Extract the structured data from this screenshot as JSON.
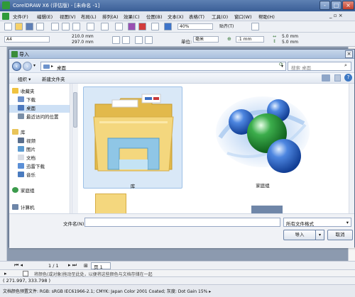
{
  "window": {
    "title": "CorelDRAW X6 (评估版) - [未命名 -1]",
    "controls": [
      "-",
      "□",
      "×"
    ]
  },
  "menu": {
    "items": [
      "文件(F)",
      "编辑(E)",
      "视图(V)",
      "布局(L)",
      "排列(A)",
      "效果(C)",
      "位图(B)",
      "文本(X)",
      "表格(T)",
      "工具(O)",
      "窗口(W)",
      "帮助(H)"
    ]
  },
  "toolbar": {
    "zoom": "40%",
    "snap": "贴齐(T)"
  },
  "property_bar": {
    "page_size": "A4",
    "width": "210.0 mm",
    "height": "297.0 mm",
    "unit_label": "单位:",
    "unit": "毫米",
    "nudge": ".1 mm",
    "dup_x": "5.0 mm",
    "dup_y": "5.0 mm"
  },
  "dialog": {
    "title": "导入",
    "close": "×",
    "address": "桌面",
    "search_placeholder": "搜索 桌面",
    "organize": "组织 ▾",
    "new_folder": "新建文件夹",
    "sidebar": {
      "favorites": "收藏夹",
      "downloads": "下载",
      "desktop": "桌面",
      "recent": "最近访问的位置",
      "libraries": "库",
      "videos": "视频",
      "pictures": "图片",
      "documents": "文档",
      "thunder": "迅雷下载",
      "music": "音乐",
      "homegroup": "家庭组",
      "computer": "计算机"
    },
    "items": {
      "library": "库",
      "homegroup": "家庭组"
    },
    "filename_label": "文件名(N):",
    "filename_value": "",
    "filetype": "所有文件格式",
    "import_button": "导入",
    "cancel_button": "取消"
  },
  "page_nav": {
    "counter": "1 / 1",
    "tab": "页 1"
  },
  "status": {
    "hint": "将颜色(或对象)拖动至此处，以便将这些颜色与文档存储在一起",
    "coords": "( 271.997, 333.798 )",
    "color_info": "文档颜色预置文件: RGB: sRGB IEC61966-2.1; CMYK: Japan Color 2001 Coated; 灰度: Dot Gain 15% ▸"
  },
  "colors": {
    "selection": "#d9e8f7",
    "titlebar": "#3b5f97",
    "green_ball": "#2e9a3e",
    "blue_ball": "#2a5fbd"
  }
}
